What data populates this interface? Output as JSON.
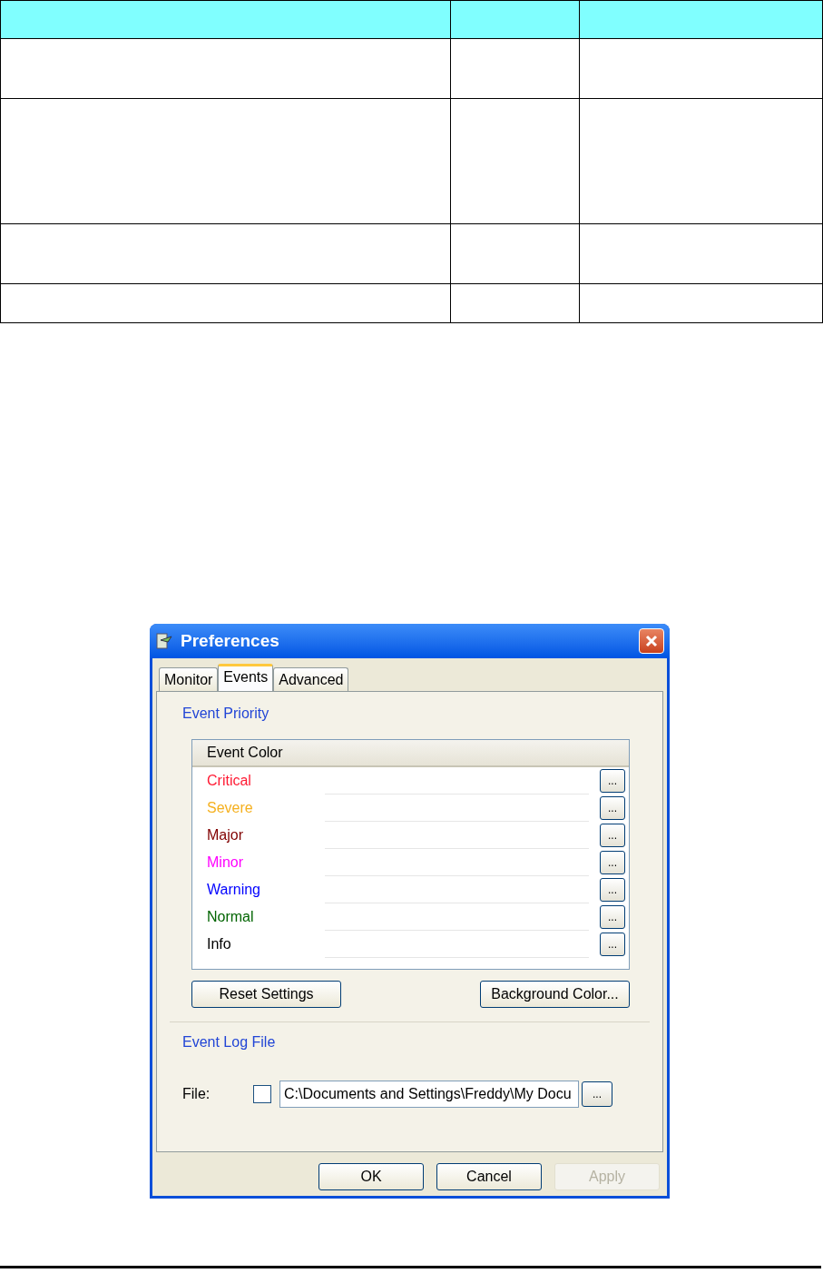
{
  "dialog": {
    "title": "Preferences",
    "tabs": [
      {
        "label": "Monitor",
        "selected": false
      },
      {
        "label": "Events",
        "selected": true
      },
      {
        "label": "Advanced",
        "selected": false
      }
    ],
    "event_priority": {
      "heading": "Event Priority",
      "column": "Event Color",
      "events": [
        {
          "name": "Critical",
          "color": "#ff1a33",
          "button": "..."
        },
        {
          "name": "Severe",
          "color": "#f5b01e",
          "button": "..."
        },
        {
          "name": "Major",
          "color": "#800000",
          "button": "..."
        },
        {
          "name": "Minor",
          "color": "#ff00ff",
          "button": "..."
        },
        {
          "name": "Warning",
          "color": "#0000ff",
          "button": "..."
        },
        {
          "name": "Normal",
          "color": "#006400",
          "button": "..."
        },
        {
          "name": "Info",
          "color": "#000000",
          "button": "..."
        }
      ],
      "buttons": [
        "Reset Settings",
        "Background Color..."
      ]
    },
    "event_log": {
      "heading": "Event Log File",
      "label": "File:",
      "checked": false,
      "value": "C:\\Documents and Settings\\Freddy\\My Docu",
      "browse": "..."
    },
    "buttons": [
      {
        "label": "OK",
        "disabled": false
      },
      {
        "label": "Cancel",
        "disabled": false
      },
      {
        "label": "Apply",
        "disabled": true
      }
    ]
  }
}
